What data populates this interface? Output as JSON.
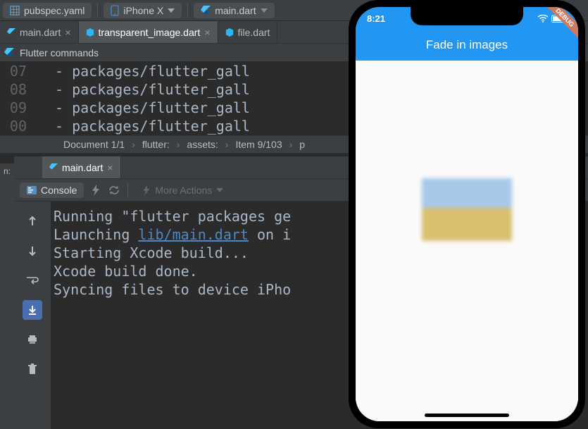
{
  "toolbar": {
    "config_label": "pubspec.yaml",
    "device_label": "iPhone X",
    "file_label": "main.dart"
  },
  "editor_tabs": [
    {
      "label": "main.dart",
      "active": false
    },
    {
      "label": "transparent_image.dart",
      "active": true
    },
    {
      "label": "file.dart",
      "active": false
    }
  ],
  "flutter_commands_label": "Flutter commands",
  "code": {
    "line_numbers": [
      "07",
      "08",
      "09",
      "00"
    ],
    "lines": [
      "- packages/flutter_gall",
      "- packages/flutter_gall",
      "- packages/flutter_gall",
      "- packages/flutter_gall"
    ]
  },
  "breadcrumb": {
    "items": [
      "Document 1/1",
      "flutter:",
      "assets:",
      "Item 9/103",
      "p"
    ]
  },
  "lower_panel": {
    "side_label": "n:",
    "tab_label": "main.dart",
    "console_label": "Console",
    "more_actions_label": "More Actions"
  },
  "console": {
    "lines": [
      "Running \"flutter packages ge",
      "Launching ",
      " on i",
      "Starting Xcode build...",
      "Xcode build done.",
      "Syncing files to device iPho"
    ],
    "link": "lib/main.dart"
  },
  "simulator": {
    "time": "8:21",
    "app_title": "Fade in images",
    "debug_label": "DEBUG"
  }
}
